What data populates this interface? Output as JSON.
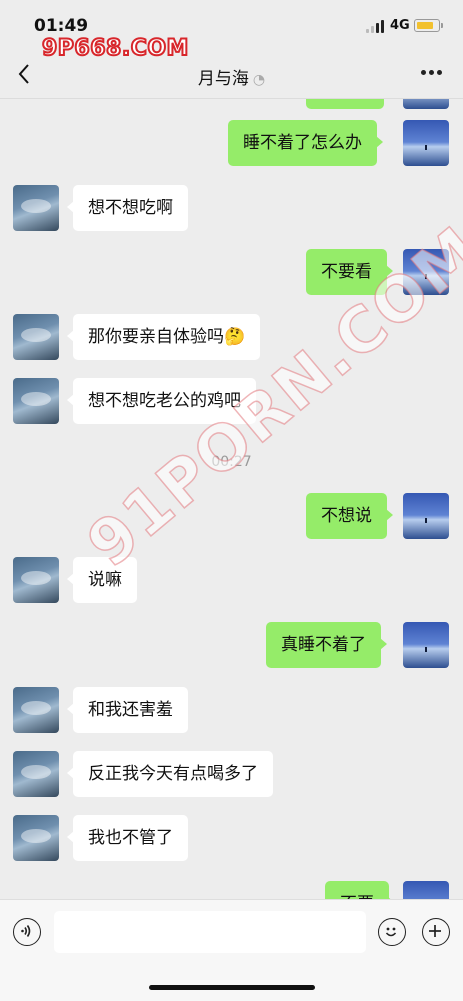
{
  "status": {
    "time": "01:49",
    "network": "4G"
  },
  "watermark_top": "9P668.COM",
  "watermark_diagonal": "91PORN.COM",
  "header": {
    "title": "月与海",
    "back_icon": "chevron-left-icon",
    "more_icon": "more-dots-icon",
    "mute_icon": "ear-icon"
  },
  "messages": [
    {
      "from": "me",
      "text": "睡不着了怎么办"
    },
    {
      "from": "other",
      "text": "想不想吃啊"
    },
    {
      "from": "me",
      "text": "不要看"
    },
    {
      "from": "other",
      "text": "那你要亲自体验吗🤔"
    },
    {
      "from": "other",
      "text": "想不想吃老公的鸡吧"
    },
    {
      "from": "me",
      "text": "不想说"
    },
    {
      "from": "other",
      "text": "说嘛"
    },
    {
      "from": "me",
      "text": "真睡不着了"
    },
    {
      "from": "other",
      "text": "和我还害羞"
    },
    {
      "from": "other",
      "text": "反正我今天有点喝多了"
    },
    {
      "from": "other",
      "text": "我也不管了"
    },
    {
      "from": "me",
      "text": "不要"
    }
  ],
  "timestamp": "00:27",
  "input": {
    "value": "",
    "voice_icon": "voice-icon",
    "emoji_icon": "emoji-icon",
    "plus_icon": "plus-icon"
  },
  "colors": {
    "self_bubble": "#95ec69",
    "other_bubble": "#ffffff",
    "background": "#ededed"
  }
}
